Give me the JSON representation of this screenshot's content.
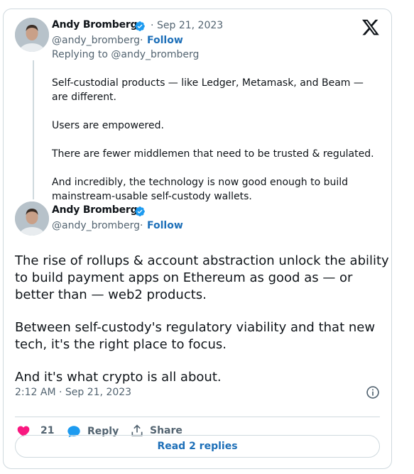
{
  "reply_tweet": {
    "author_name": "Andy Bromberg",
    "date": "Sep 21, 2023",
    "date_sep": "·",
    "handle": "@andy_bromberg",
    "follow_sep": "·",
    "follow": "Follow",
    "replying_to": "Replying to @andy_bromberg",
    "paragraphs": [
      "Self-custodial products — like Ledger, Metamask, and Beam — are different.",
      "Users are empowered.",
      "There are fewer middlemen that need to be trusted & regulated.",
      "And incredibly, the technology is now good enough to build mainstream-usable self-custody wallets."
    ]
  },
  "main_tweet": {
    "author_name": "Andy Bromberg",
    "handle": "@andy_bromberg",
    "follow_sep": "·",
    "follow": "Follow",
    "paragraphs": [
      "The rise of rollups & account abstraction unlock the ability to build payment apps on Ethereum as good as — or better than  — web2 products.",
      "Between self-custody's regulatory viability and that new tech, it's the right place to focus.",
      "And it's what crypto is all about."
    ],
    "timestamp": "2:12 AM · Sep 21, 2023"
  },
  "actions": {
    "like_count": "21",
    "reply_label": "Reply",
    "share_label": "Share",
    "read_replies": "Read 2 replies"
  },
  "colors": {
    "link": "#1d6fb8",
    "verified": "#1d9bf0",
    "like": "#f91880",
    "muted": "#536471"
  },
  "icons": [
    "verified-badge-icon",
    "x-logo-icon",
    "info-icon",
    "heart-icon",
    "reply-bubble-icon",
    "share-icon"
  ]
}
